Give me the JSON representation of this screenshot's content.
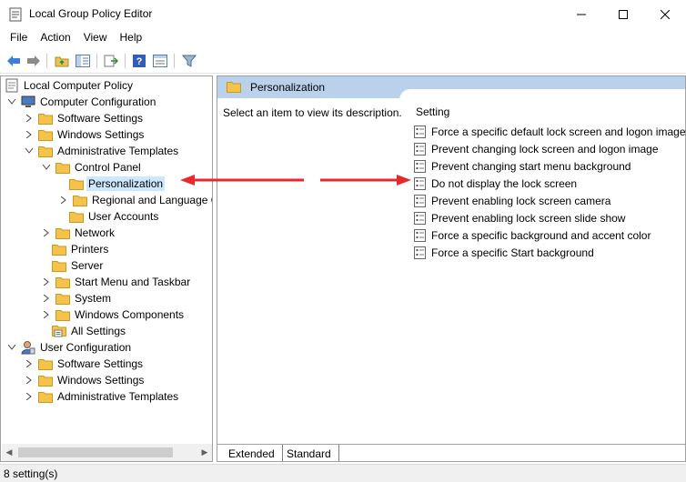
{
  "window": {
    "title": "Local Group Policy Editor"
  },
  "menu": [
    "File",
    "Action",
    "View",
    "Help"
  ],
  "tree": {
    "root": "Local Computer Policy",
    "computer_config": "Computer Configuration",
    "cc_software": "Software Settings",
    "cc_windows": "Windows Settings",
    "cc_admin": "Administrative Templates",
    "control_panel": "Control Panel",
    "personalization": "Personalization",
    "regional": "Regional and Language Options",
    "user_accounts": "User Accounts",
    "network": "Network",
    "printers": "Printers",
    "server": "Server",
    "start_menu": "Start Menu and Taskbar",
    "system": "System",
    "windows_components": "Windows Components",
    "all_settings": "All Settings",
    "user_config": "User Configuration",
    "uc_software": "Software Settings",
    "uc_windows": "Windows Settings",
    "uc_admin": "Administrative Templates"
  },
  "right_pane": {
    "header_title": "Personalization",
    "description": "Select an item to view its description.",
    "column_header": "Setting",
    "settings": [
      "Force a specific default lock screen and logon image",
      "Prevent changing lock screen and logon image",
      "Prevent changing start menu background",
      "Do not display the lock screen",
      "Prevent enabling lock screen camera",
      "Prevent enabling lock screen slide show",
      "Force a specific background and accent color",
      "Force a specific Start background"
    ],
    "tabs": [
      "Extended",
      "Standard"
    ]
  },
  "status": {
    "text": "8 setting(s)"
  },
  "colors": {
    "annotation_arrow": "#e8292b",
    "selection": "#cce8ff",
    "header_band": "#b9d1ea",
    "folder": "#f5c34a"
  }
}
